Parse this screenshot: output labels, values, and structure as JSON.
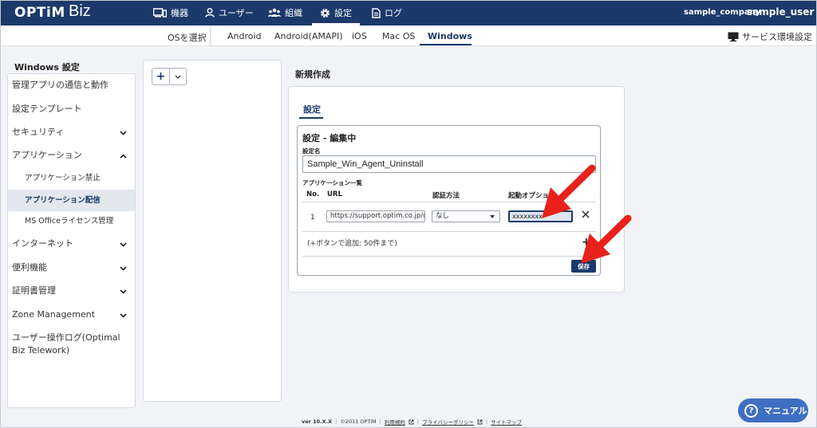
{
  "header": {
    "logo": "OPTiM",
    "logo_suffix": "Biz",
    "nav": [
      {
        "label": "機器",
        "icon": "devices-icon"
      },
      {
        "label": "ユーザー",
        "icon": "user-icon"
      },
      {
        "label": "組織",
        "icon": "organization-icon"
      },
      {
        "label": "設定",
        "icon": "gear-icon",
        "active": true
      },
      {
        "label": "ログ",
        "icon": "log-icon"
      }
    ],
    "company": "sample_company",
    "user": "sample_user"
  },
  "os_bar": {
    "select_label": "OSを選択",
    "tabs": [
      "Android",
      "Android(AMAPI)",
      "iOS",
      "Mac OS",
      "Windows"
    ],
    "active_tab": "Windows",
    "service_settings": "サービス環境設定"
  },
  "sidebar": {
    "title": "Windows 設定",
    "items": [
      {
        "label": "管理アプリの通信と動作"
      },
      {
        "label": "設定テンプレート"
      },
      {
        "label": "セキュリティ",
        "chevron": "down"
      },
      {
        "label": "アプリケーション",
        "chevron": "up"
      },
      {
        "label": "アプリケーション禁止",
        "sub": true
      },
      {
        "label": "アプリケーション配信",
        "sub": true,
        "active": true
      },
      {
        "label": "MS Officeライセンス管理",
        "sub": true
      },
      {
        "label": "インターネット",
        "chevron": "down"
      },
      {
        "label": "便利機能",
        "chevron": "down"
      },
      {
        "label": "証明書管理",
        "chevron": "down"
      },
      {
        "label": "Zone Management",
        "chevron": "down"
      },
      {
        "label": "ユーザー操作ログ(Optimal Biz Telework)"
      }
    ]
  },
  "main": {
    "title": "新規作成",
    "tab": "設定",
    "editor_title": "設定 - 編集中",
    "name_label": "設定名",
    "name_value": "Sample_Win_Agent_Uninstall",
    "app_list_label": "アプリケーション一覧",
    "columns": [
      "No.",
      "URL",
      "認証方法",
      "起動オプション"
    ],
    "rows": [
      {
        "no": "1",
        "url": "https://support.optim.co.jp/c",
        "auth": "なし",
        "option": "xxxxxxxx"
      }
    ],
    "add_note": "(+ボタンで追加: 50件まで)",
    "save_label": "保存"
  },
  "footer": {
    "version": "ver 10.X.X",
    "copyright": "©2011 OPTiM",
    "terms": "利用規約",
    "privacy": "プライバシーポリシー",
    "sitemap": "サイトマップ"
  },
  "manual_button": "マニュアル",
  "colors": {
    "brand": "#1b3a6b",
    "accent": "#3f6fc2",
    "annotation_arrow": "#e8211a"
  }
}
